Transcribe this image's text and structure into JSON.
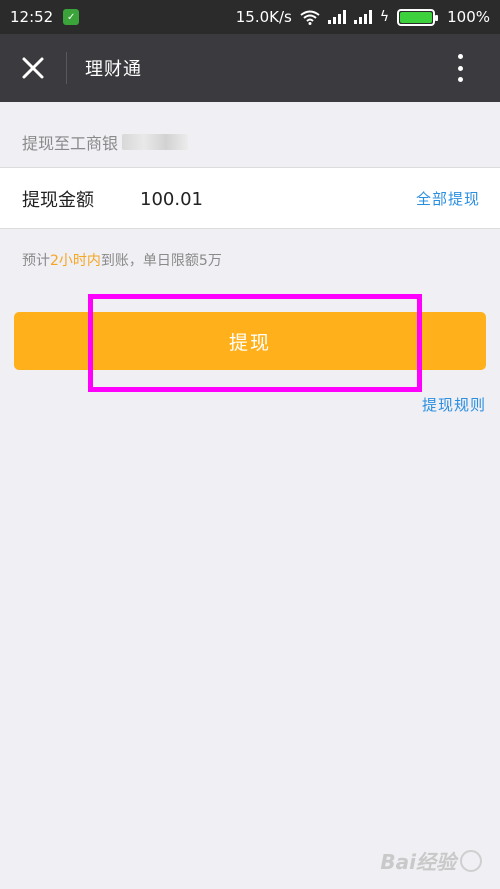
{
  "status_bar": {
    "time": "12:52",
    "network_speed": "15.0K/s",
    "battery": "100%",
    "icons": [
      "shield-icon",
      "wifi-icon",
      "signal-icon",
      "signal-icon",
      "charging-icon",
      "battery-icon"
    ]
  },
  "header": {
    "title": "理财通",
    "close_icon": "close-icon",
    "more_icon": "more-vertical-icon"
  },
  "bank": {
    "label": "提现至工商银"
  },
  "amount": {
    "label": "提现金额",
    "value": "100.01",
    "withdraw_all": "全部提现"
  },
  "estimate": {
    "prefix": "预计",
    "highlight": "2小时内",
    "suffix": "到账，单日限额5万"
  },
  "actions": {
    "withdraw": "提现",
    "rules": "提现规则"
  },
  "watermark": {
    "text": "Bai经验"
  },
  "colors": {
    "accent_button": "#ffb01a",
    "link": "#2b8fe0",
    "highlight_text": "#f5a623",
    "annotation_box": "#ff00ff",
    "title_bar": "#3b3b3f"
  }
}
